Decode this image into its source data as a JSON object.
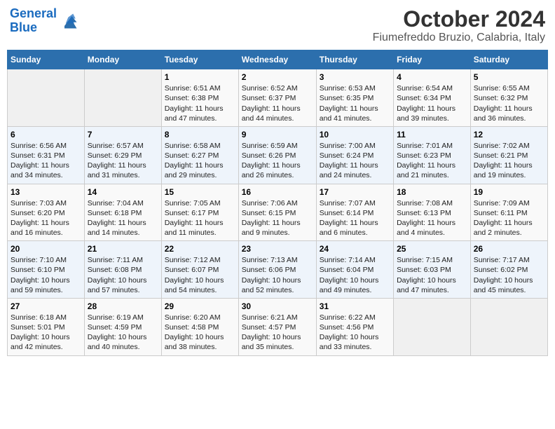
{
  "header": {
    "logo_line1": "General",
    "logo_line2": "Blue",
    "title": "October 2024",
    "subtitle": "Fiumefreddo Bruzio, Calabria, Italy"
  },
  "days_of_week": [
    "Sunday",
    "Monday",
    "Tuesday",
    "Wednesday",
    "Thursday",
    "Friday",
    "Saturday"
  ],
  "weeks": [
    [
      {
        "day": "",
        "content": ""
      },
      {
        "day": "",
        "content": ""
      },
      {
        "day": "1",
        "content": "Sunrise: 6:51 AM\nSunset: 6:38 PM\nDaylight: 11 hours and 47 minutes."
      },
      {
        "day": "2",
        "content": "Sunrise: 6:52 AM\nSunset: 6:37 PM\nDaylight: 11 hours and 44 minutes."
      },
      {
        "day": "3",
        "content": "Sunrise: 6:53 AM\nSunset: 6:35 PM\nDaylight: 11 hours and 41 minutes."
      },
      {
        "day": "4",
        "content": "Sunrise: 6:54 AM\nSunset: 6:34 PM\nDaylight: 11 hours and 39 minutes."
      },
      {
        "day": "5",
        "content": "Sunrise: 6:55 AM\nSunset: 6:32 PM\nDaylight: 11 hours and 36 minutes."
      }
    ],
    [
      {
        "day": "6",
        "content": "Sunrise: 6:56 AM\nSunset: 6:31 PM\nDaylight: 11 hours and 34 minutes."
      },
      {
        "day": "7",
        "content": "Sunrise: 6:57 AM\nSunset: 6:29 PM\nDaylight: 11 hours and 31 minutes."
      },
      {
        "day": "8",
        "content": "Sunrise: 6:58 AM\nSunset: 6:27 PM\nDaylight: 11 hours and 29 minutes."
      },
      {
        "day": "9",
        "content": "Sunrise: 6:59 AM\nSunset: 6:26 PM\nDaylight: 11 hours and 26 minutes."
      },
      {
        "day": "10",
        "content": "Sunrise: 7:00 AM\nSunset: 6:24 PM\nDaylight: 11 hours and 24 minutes."
      },
      {
        "day": "11",
        "content": "Sunrise: 7:01 AM\nSunset: 6:23 PM\nDaylight: 11 hours and 21 minutes."
      },
      {
        "day": "12",
        "content": "Sunrise: 7:02 AM\nSunset: 6:21 PM\nDaylight: 11 hours and 19 minutes."
      }
    ],
    [
      {
        "day": "13",
        "content": "Sunrise: 7:03 AM\nSunset: 6:20 PM\nDaylight: 11 hours and 16 minutes."
      },
      {
        "day": "14",
        "content": "Sunrise: 7:04 AM\nSunset: 6:18 PM\nDaylight: 11 hours and 14 minutes."
      },
      {
        "day": "15",
        "content": "Sunrise: 7:05 AM\nSunset: 6:17 PM\nDaylight: 11 hours and 11 minutes."
      },
      {
        "day": "16",
        "content": "Sunrise: 7:06 AM\nSunset: 6:15 PM\nDaylight: 11 hours and 9 minutes."
      },
      {
        "day": "17",
        "content": "Sunrise: 7:07 AM\nSunset: 6:14 PM\nDaylight: 11 hours and 6 minutes."
      },
      {
        "day": "18",
        "content": "Sunrise: 7:08 AM\nSunset: 6:13 PM\nDaylight: 11 hours and 4 minutes."
      },
      {
        "day": "19",
        "content": "Sunrise: 7:09 AM\nSunset: 6:11 PM\nDaylight: 11 hours and 2 minutes."
      }
    ],
    [
      {
        "day": "20",
        "content": "Sunrise: 7:10 AM\nSunset: 6:10 PM\nDaylight: 10 hours and 59 minutes."
      },
      {
        "day": "21",
        "content": "Sunrise: 7:11 AM\nSunset: 6:08 PM\nDaylight: 10 hours and 57 minutes."
      },
      {
        "day": "22",
        "content": "Sunrise: 7:12 AM\nSunset: 6:07 PM\nDaylight: 10 hours and 54 minutes."
      },
      {
        "day": "23",
        "content": "Sunrise: 7:13 AM\nSunset: 6:06 PM\nDaylight: 10 hours and 52 minutes."
      },
      {
        "day": "24",
        "content": "Sunrise: 7:14 AM\nSunset: 6:04 PM\nDaylight: 10 hours and 49 minutes."
      },
      {
        "day": "25",
        "content": "Sunrise: 7:15 AM\nSunset: 6:03 PM\nDaylight: 10 hours and 47 minutes."
      },
      {
        "day": "26",
        "content": "Sunrise: 7:17 AM\nSunset: 6:02 PM\nDaylight: 10 hours and 45 minutes."
      }
    ],
    [
      {
        "day": "27",
        "content": "Sunrise: 6:18 AM\nSunset: 5:01 PM\nDaylight: 10 hours and 42 minutes."
      },
      {
        "day": "28",
        "content": "Sunrise: 6:19 AM\nSunset: 4:59 PM\nDaylight: 10 hours and 40 minutes."
      },
      {
        "day": "29",
        "content": "Sunrise: 6:20 AM\nSunset: 4:58 PM\nDaylight: 10 hours and 38 minutes."
      },
      {
        "day": "30",
        "content": "Sunrise: 6:21 AM\nSunset: 4:57 PM\nDaylight: 10 hours and 35 minutes."
      },
      {
        "day": "31",
        "content": "Sunrise: 6:22 AM\nSunset: 4:56 PM\nDaylight: 10 hours and 33 minutes."
      },
      {
        "day": "",
        "content": ""
      },
      {
        "day": "",
        "content": ""
      }
    ]
  ]
}
